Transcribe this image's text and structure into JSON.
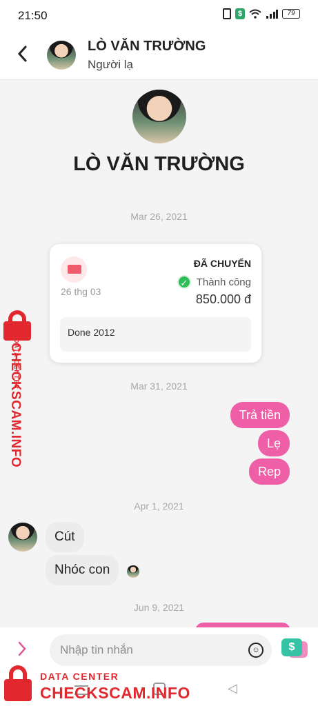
{
  "status_bar": {
    "time": "21:50",
    "battery": "79",
    "icons": [
      "vibrate-icon",
      "money-icon",
      "wifi-icon",
      "signal-icon",
      "battery-icon"
    ]
  },
  "header": {
    "back_icon": "chevron-left-icon",
    "name": "LÒ VĂN TRƯỜNG",
    "subtitle": "Người lạ"
  },
  "profile": {
    "name": "LÒ VĂN TRƯỜNG"
  },
  "dates": {
    "d1": "Mar 26, 2021",
    "d2": "Mar 31, 2021",
    "d3": "Apr 1, 2021",
    "d4": "Jun 9, 2021"
  },
  "transaction": {
    "date": "26 thg 03",
    "status": "ĐÃ CHUYỂN",
    "result": "Thành công",
    "amount": "850.000 đ",
    "note": "Done 2012",
    "icon": "money-transfer-icon"
  },
  "messages_sent": [
    {
      "text": "Trả tiền"
    },
    {
      "text": "Lẹ"
    },
    {
      "text": "Rep"
    }
  ],
  "messages_received": [
    {
      "text": "Cút"
    },
    {
      "text": "Nhóc con"
    }
  ],
  "composer": {
    "placeholder": "Nhập tin nhắn",
    "pay_symbol": "$"
  },
  "watermark": {
    "small": "DATA CENTER",
    "big": "CHECKSCAM.INFO"
  },
  "colors": {
    "accent": "#ef5fa7",
    "success": "#2ebd56",
    "watermark": "#e0282e"
  }
}
